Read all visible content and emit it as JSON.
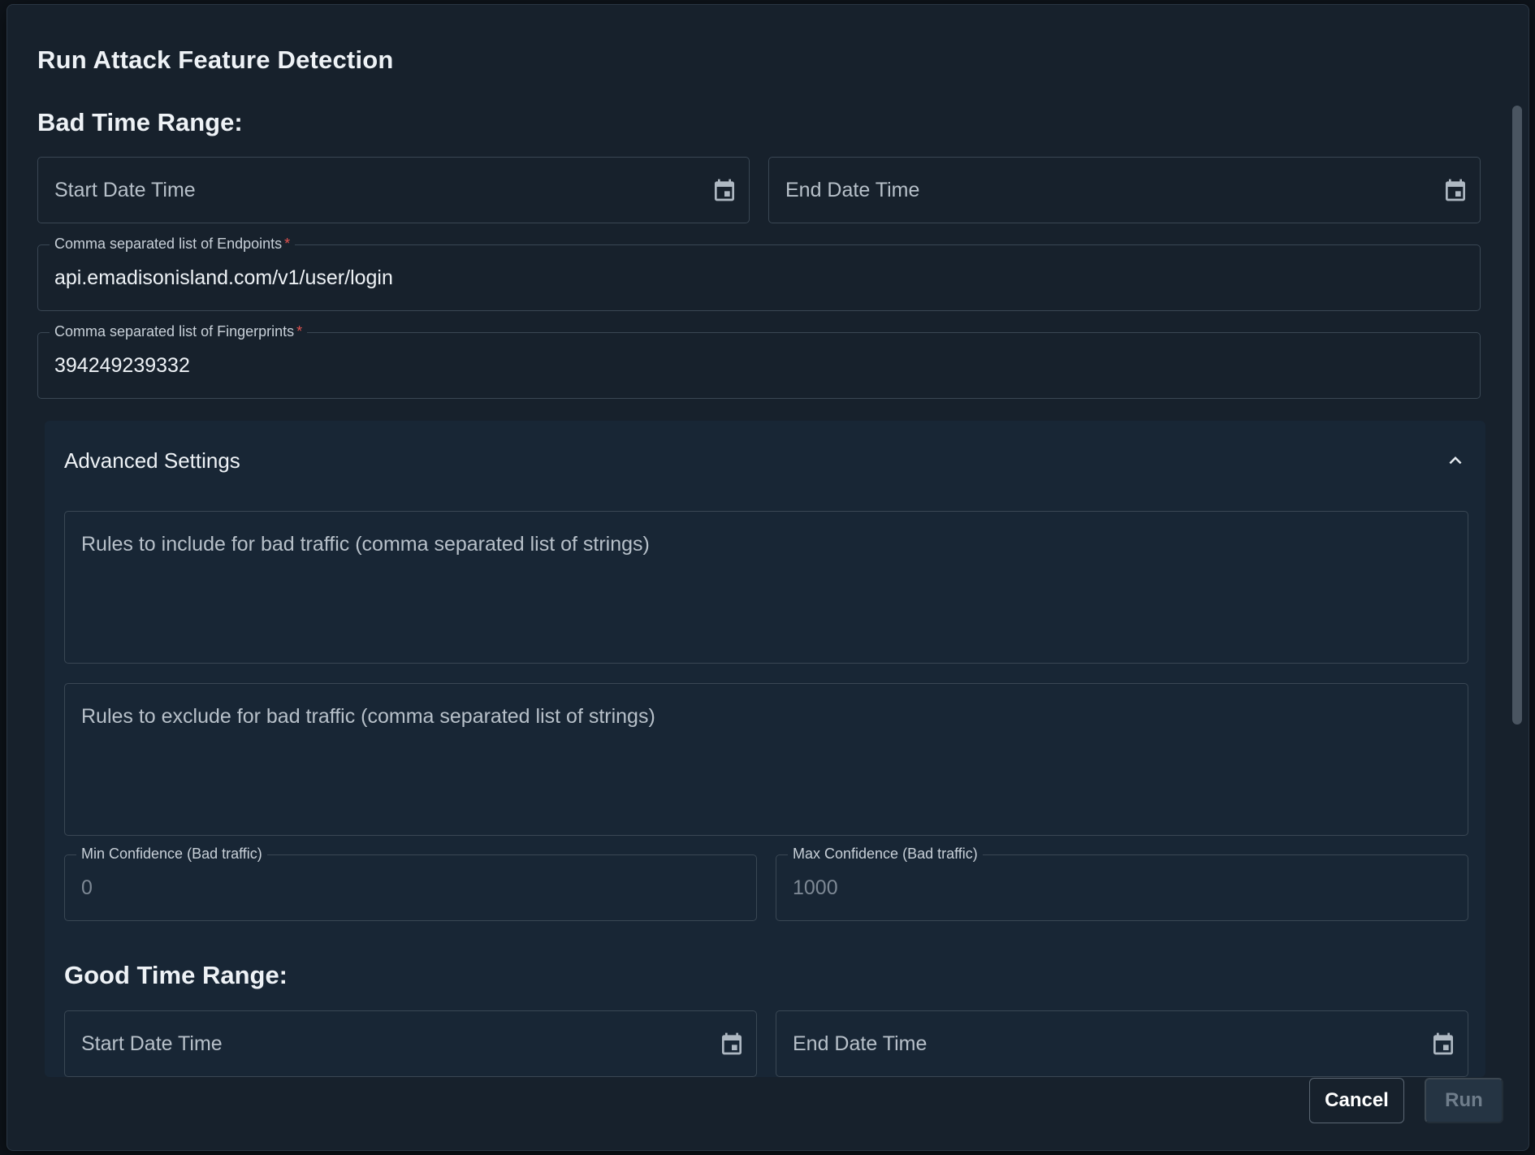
{
  "dialog": {
    "title": "Run Attack Feature Detection"
  },
  "bad_time_range": {
    "heading": "Bad Time Range:",
    "start_placeholder": "Start Date Time",
    "end_placeholder": "End Date Time"
  },
  "endpoints": {
    "label": "Comma separated list of Endpoints",
    "required_mark": "*",
    "value": "api.emadisonisland.com/v1/user/login"
  },
  "fingerprints": {
    "label": "Comma separated list of Fingerprints",
    "required_mark": "*",
    "value": "394249239332"
  },
  "advanced_settings": {
    "title": "Advanced Settings",
    "expanded": true,
    "rules_include_placeholder": "Rules to include for bad traffic (comma separated list of strings)",
    "rules_exclude_placeholder": "Rules to exclude for bad traffic (comma separated list of strings)",
    "min_confidence": {
      "label": "Min Confidence (Bad traffic)",
      "placeholder": "0"
    },
    "max_confidence": {
      "label": "Max Confidence (Bad traffic)",
      "placeholder": "1000"
    }
  },
  "good_time_range": {
    "heading": "Good Time Range:",
    "start_placeholder": "Start Date Time",
    "end_placeholder": "End Date Time"
  },
  "footer": {
    "cancel_label": "Cancel",
    "run_label": "Run",
    "run_enabled": false
  },
  "icons": {
    "calendar": "calendar-icon",
    "chevron": "chevron-up-icon"
  },
  "colors": {
    "dialog_bg": "#17212c",
    "panel_bg": "#182635",
    "required": "#e0524f",
    "border": "#3a4754"
  }
}
